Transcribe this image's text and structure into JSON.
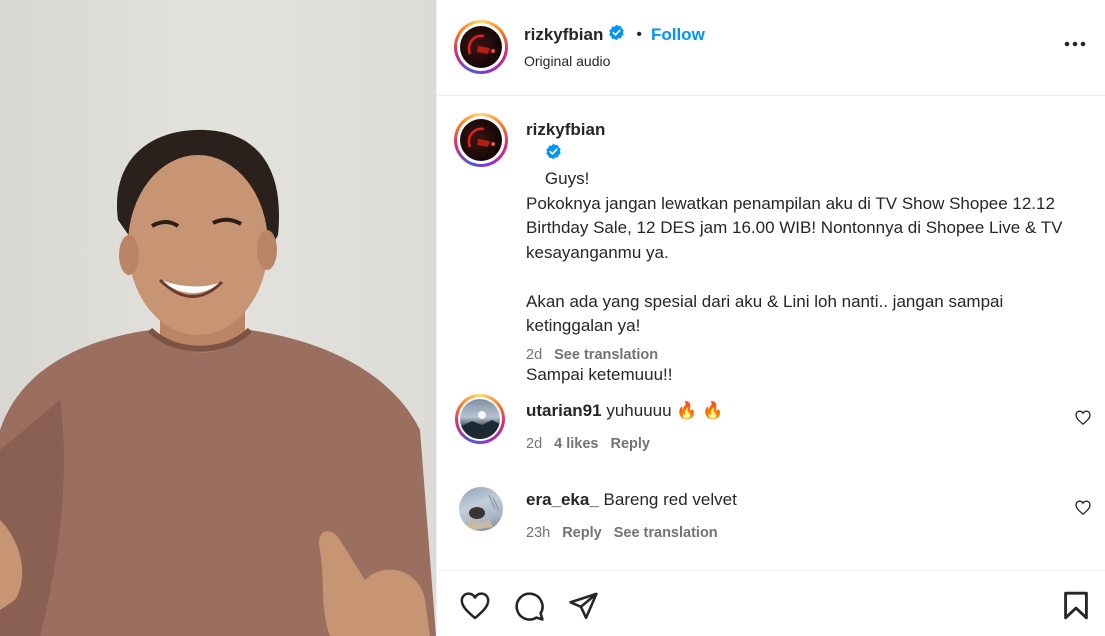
{
  "header": {
    "username": "rizkyfbian",
    "separator": "•",
    "follow_label": "Follow",
    "subtitle": "Original audio"
  },
  "caption": {
    "username": "rizkyfbian",
    "text": "Guys!\nPokoknya jangan lewatkan penampilan aku di TV Show Shopee 12.12 Birthday Sale, 12 DES jam 16.00 WIB! Nontonnya di Shopee Live & TV kesayanganmu ya.\n\nAkan ada yang spesial dari aku & Lini loh nanti.. jangan sampai ketinggalan ya!\n\nSampai ketemuuu!!",
    "time": "2d",
    "translate_label": "See translation"
  },
  "comments": [
    {
      "username": "utarian91",
      "text": "yuhuuuu 🔥 🔥",
      "time": "2d",
      "likes": "4 likes",
      "reply_label": "Reply"
    },
    {
      "username": "era_eka_",
      "text": "Bareng red velvet",
      "time": "23h",
      "reply_label": "Reply",
      "translate_label": "See translation"
    }
  ],
  "icons": {
    "verified": "verified-badge-icon",
    "more": "more-options-icon",
    "like": "heart-icon",
    "comment": "comment-icon",
    "share": "share-icon",
    "save": "bookmark-icon"
  },
  "colors": {
    "accent": "#0095f6",
    "text": "#262626",
    "muted": "#737373"
  }
}
